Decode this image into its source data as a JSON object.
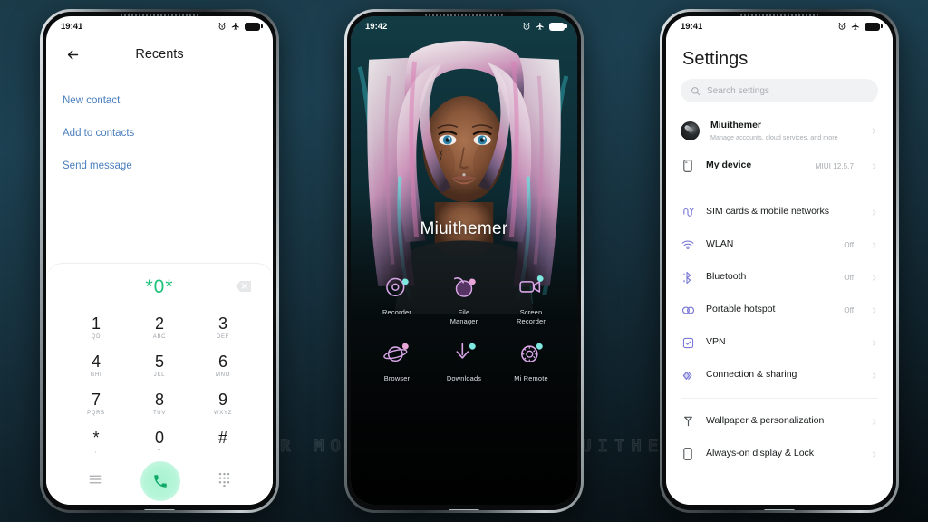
{
  "watermark": "VISIT FOR MORE THEMES - MIUITHEMER.COM",
  "theme": {
    "background_top": "#1b3b49",
    "background_bottom": "#060d11",
    "link_blue": "#4a7fbd",
    "dial_green": "#1fc27a",
    "settings_icon_purple": "#7a78d6",
    "neon_pink": "#e6a6e8",
    "neon_cyan": "#7fe8e0"
  },
  "phone1": {
    "name": "dialer-recents",
    "statusbar": {
      "time": "19:41",
      "icons": [
        "alarm-icon",
        "airplane-mode-icon",
        "battery-icon"
      ]
    },
    "header": {
      "back": "back-arrow-icon",
      "title": "Recents"
    },
    "links": [
      {
        "label": "New contact"
      },
      {
        "label": "Add to contacts"
      },
      {
        "label": "Send message"
      }
    ],
    "dial": {
      "number": "*0*",
      "backspace": "backspace-icon",
      "keys": [
        {
          "num": "1",
          "sub": "QD"
        },
        {
          "num": "2",
          "sub": "ABC"
        },
        {
          "num": "3",
          "sub": "DEF"
        },
        {
          "num": "4",
          "sub": "GHI"
        },
        {
          "num": "5",
          "sub": "JKL"
        },
        {
          "num": "6",
          "sub": "MNO"
        },
        {
          "num": "7",
          "sub": "PQRS"
        },
        {
          "num": "8",
          "sub": "TUV"
        },
        {
          "num": "9",
          "sub": "WXYZ"
        },
        {
          "num": "*",
          "sub": ","
        },
        {
          "num": "0",
          "sub": "+"
        },
        {
          "num": "#",
          "sub": ""
        }
      ]
    },
    "nav": {
      "menu": "menu-icon",
      "call": "call-icon",
      "keypad": "keypad-icon"
    }
  },
  "phone2": {
    "name": "home-screen",
    "statusbar": {
      "time": "19:42",
      "icons": [
        "alarm-icon",
        "airplane-mode-icon",
        "battery-icon"
      ]
    },
    "profile_name": "Miuithemer",
    "apps": [
      {
        "label": "Recorder",
        "icon": "recorder-icon"
      },
      {
        "label": "File\nManager",
        "icon": "file-manager-icon"
      },
      {
        "label": "Screen\nRecorder",
        "icon": "screen-recorder-icon"
      },
      {
        "label": "Browser",
        "icon": "browser-icon"
      },
      {
        "label": "Downloads",
        "icon": "downloads-icon"
      },
      {
        "label": "Mi Remote",
        "icon": "mi-remote-icon"
      }
    ]
  },
  "phone3": {
    "name": "settings",
    "statusbar": {
      "time": "19:41",
      "icons": [
        "alarm-icon",
        "airplane-mode-icon",
        "battery-icon"
      ]
    },
    "title": "Settings",
    "search": {
      "placeholder": "Search settings",
      "icon": "search-icon"
    },
    "account": {
      "name": "Miuithemer",
      "subtitle": "Manage accounts, cloud services, and more",
      "icon": "avatar"
    },
    "device": {
      "label": "My device",
      "value": "MIUI 12.5.7",
      "icon": "phone-icon"
    },
    "items": [
      {
        "label": "SIM cards & mobile networks",
        "value": "",
        "icon": "sim-icon"
      },
      {
        "label": "WLAN",
        "value": "Off",
        "icon": "wifi-icon"
      },
      {
        "label": "Bluetooth",
        "value": "Off",
        "icon": "bluetooth-icon"
      },
      {
        "label": "Portable hotspot",
        "value": "Off",
        "icon": "hotspot-icon"
      },
      {
        "label": "VPN",
        "value": "",
        "icon": "vpn-icon"
      },
      {
        "label": "Connection & sharing",
        "value": "",
        "icon": "connection-sharing-icon"
      }
    ],
    "items2": [
      {
        "label": "Wallpaper & personalization",
        "value": "",
        "icon": "wallpaper-icon"
      },
      {
        "label": "Always-on display & Lock",
        "value": "",
        "icon": "aod-icon"
      }
    ]
  }
}
